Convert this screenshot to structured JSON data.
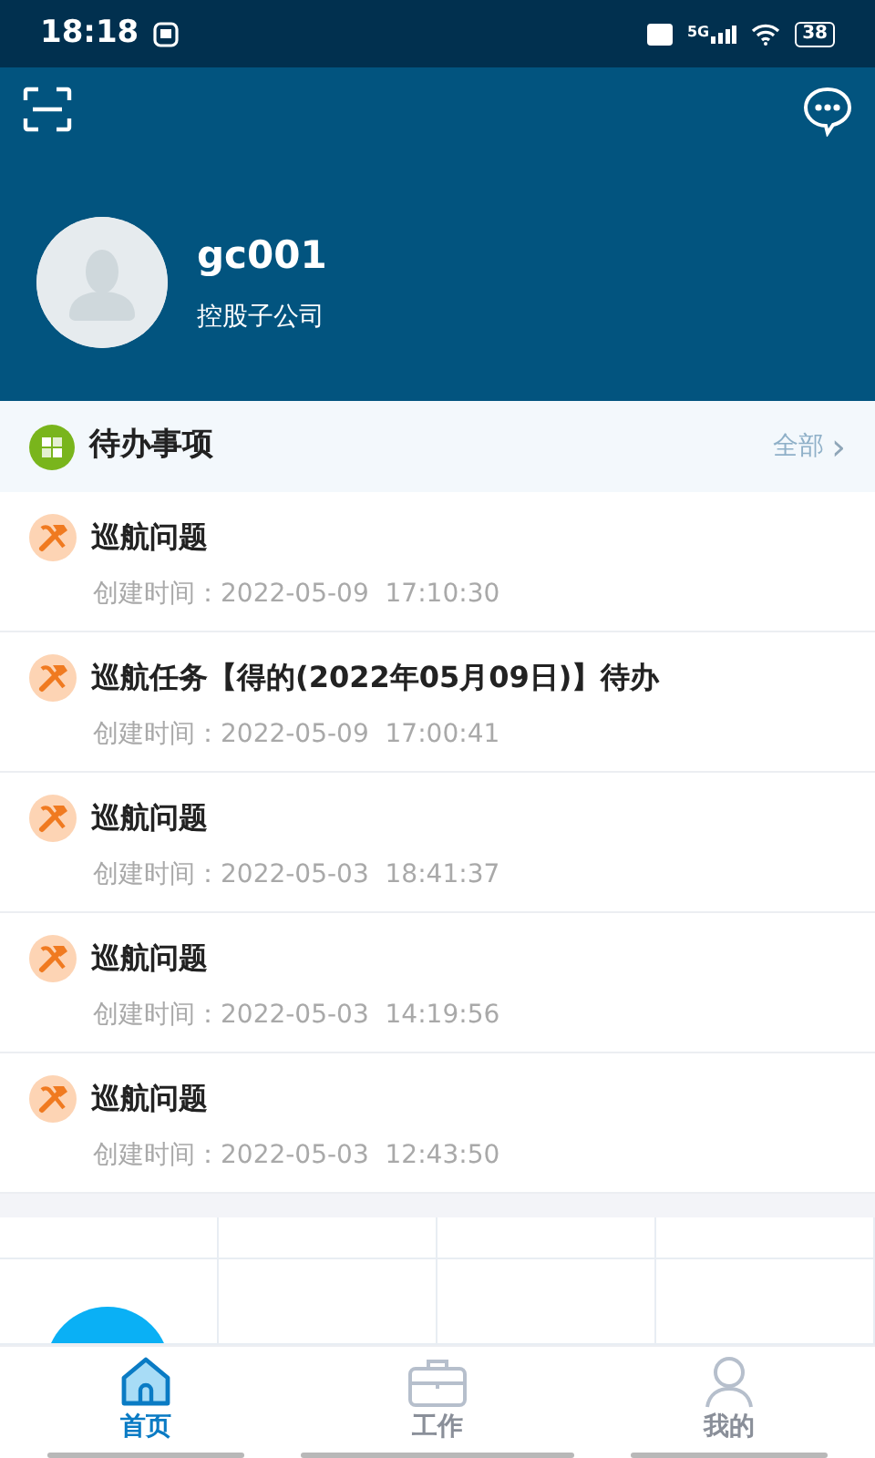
{
  "status_bar": {
    "time": "18:18",
    "battery": "38",
    "network": "5G"
  },
  "header": {
    "username": "gc001",
    "company": "控股子公司"
  },
  "todo": {
    "title": "待办事项",
    "more": "全部",
    "more_arrow": "›",
    "items": [
      {
        "title": "巡航问题",
        "created": "创建时间：2022-05-09  17:10:30"
      },
      {
        "title": "巡航任务【得的(2022年05月09日)】待办",
        "created": "创建时间：2022-05-09  17:00:41"
      },
      {
        "title": "巡航问题",
        "created": "创建时间：2022-05-03  18:41:37"
      },
      {
        "title": "巡航问题",
        "created": "创建时间：2022-05-03  14:19:56"
      },
      {
        "title": "巡航问题",
        "created": "创建时间：2022-05-03  12:43:50"
      }
    ]
  },
  "tab_bar": [
    {
      "label": "首页",
      "kind": "home",
      "selected": true
    },
    {
      "label": "工作",
      "kind": "work",
      "selected": false
    },
    {
      "label": "我的",
      "kind": "me",
      "selected": false
    }
  ]
}
